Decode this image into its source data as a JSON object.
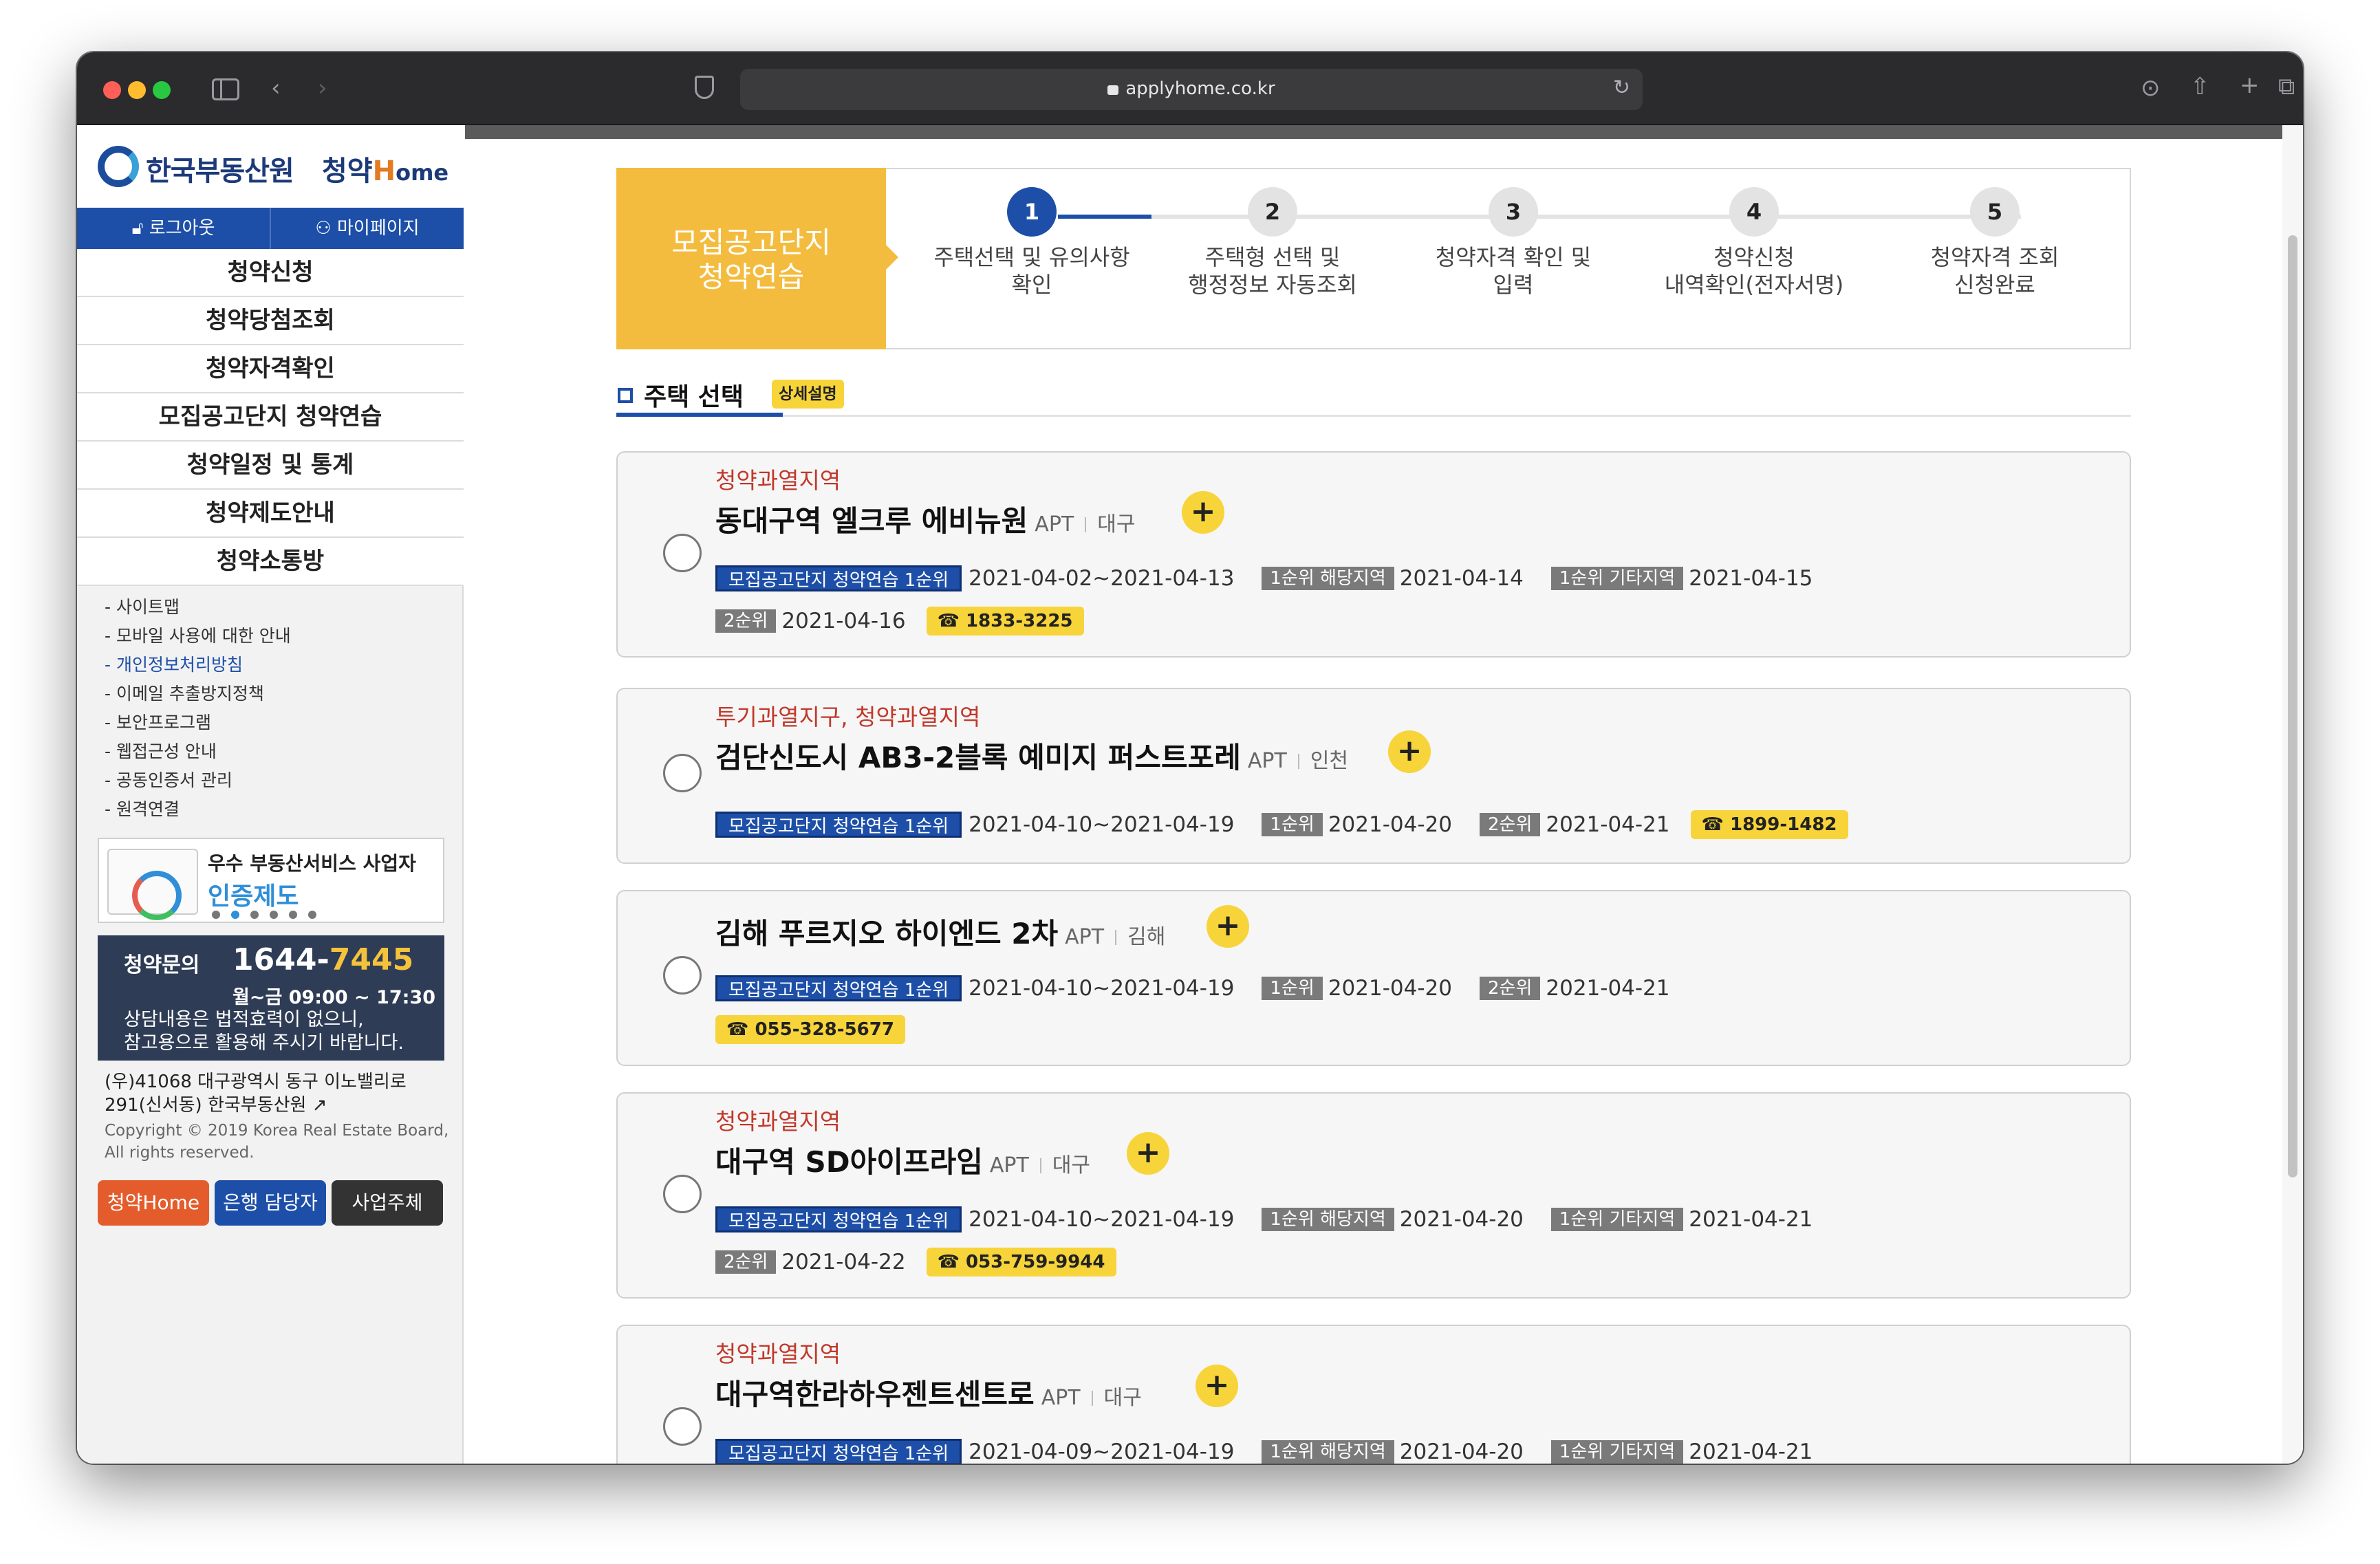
{
  "browser": {
    "url": "applyhome.co.kr"
  },
  "sidebar": {
    "logo_text": "한국부동산원",
    "logo_brand_prefix": "청약",
    "logo_brand_h": "H",
    "logo_brand_suffix": "ome",
    "logout": "로그아웃",
    "mypage": "마이페이지",
    "menu": [
      "청약신청",
      "청약당첨조회",
      "청약자격확인",
      "모집공고단지 청약연습",
      "청약일정 및 통계",
      "청약제도안내",
      "청약소통방"
    ],
    "links": [
      "- 사이트맵",
      "- 모바일 사용에 대한 안내",
      "- 개인정보처리방침",
      "- 이메일 추출방지정책",
      "- 보안프로그램",
      "- 웹접근성 안내",
      "- 공동인증서 관리",
      "- 원격연결"
    ],
    "cert_line1": "우수 부동산서비스 사업자",
    "cert_line2": "인증제도",
    "inquiry_label": "청약문의",
    "inquiry_phone_a": "1644-",
    "inquiry_phone_b": "7445",
    "inquiry_hours": "월~금 09:00 ~ 17:30",
    "inquiry_note1": "상담내용은 법적효력이 없으니,",
    "inquiry_note2": "참고용으로 활용해 주시기 바랍니다.",
    "address1": "(우)41068 대구광역시 동구 이노밸리로",
    "address2": "291(신서동) 한국부동산원",
    "copyright1": "Copyright © 2019 Korea Real Estate Board,",
    "copyright2": "All rights reserved.",
    "btn_home": "청약Home",
    "btn_bank": "은행 담당자",
    "btn_biz": "사업주체"
  },
  "steps": {
    "title1": "모집공고단지",
    "title2": "청약연습",
    "items": [
      {
        "num": "1",
        "line1": "주택선택 및 유의사항",
        "line2": "확인"
      },
      {
        "num": "2",
        "line1": "주택형 선택 및",
        "line2": "행정정보 자동조회"
      },
      {
        "num": "3",
        "line1": "청약자격 확인 및",
        "line2": "입력"
      },
      {
        "num": "4",
        "line1": "청약신청",
        "line2": "내역확인(전자서명)"
      },
      {
        "num": "5",
        "line1": "청약자격 조회",
        "line2": "신청완료"
      }
    ]
  },
  "section": {
    "title": "주택 선택",
    "badge": "상세설명"
  },
  "cards": [
    {
      "tag": "청약과열지역",
      "name": "동대구역 엘크루 에비뉴원",
      "type": "APT",
      "region": "대구",
      "row1": [
        {
          "label": "모집공고단지 청약연습 1순위",
          "kind": "blue",
          "date": "2021-04-02~2021-04-13"
        },
        {
          "label": "1순위 해당지역",
          "kind": "gray",
          "date": "2021-04-14"
        },
        {
          "label": "1순위 기타지역",
          "kind": "gray",
          "date": "2021-04-15"
        }
      ],
      "row2": [
        {
          "label": "2순위",
          "kind": "gray",
          "date": "2021-04-16"
        }
      ],
      "phone": "☎ 1833-3225"
    },
    {
      "tag": "투기과열지구, 청약과열지역",
      "name": "검단신도시 AB3-2블록 예미지 퍼스트포레",
      "type": "APT",
      "region": "인천",
      "row1": [
        {
          "label": "모집공고단지 청약연습 1순위",
          "kind": "blue",
          "date": "2021-04-10~2021-04-19"
        },
        {
          "label": "1순위",
          "kind": "gray",
          "date": "2021-04-20"
        },
        {
          "label": "2순위",
          "kind": "gray",
          "date": "2021-04-21"
        }
      ],
      "row2": [],
      "phone": "☎ 1899-1482"
    },
    {
      "tag": "",
      "name": "김해 푸르지오 하이엔드 2차",
      "type": "APT",
      "region": "김해",
      "row1": [
        {
          "label": "모집공고단지 청약연습 1순위",
          "kind": "blue",
          "date": "2021-04-10~2021-04-19"
        },
        {
          "label": "1순위",
          "kind": "gray",
          "date": "2021-04-20"
        },
        {
          "label": "2순위",
          "kind": "gray",
          "date": "2021-04-21"
        }
      ],
      "row2": [],
      "phone": "☎ 055-328-5677"
    },
    {
      "tag": "청약과열지역",
      "name": "대구역 SD아이프라임",
      "type": "APT",
      "region": "대구",
      "row1": [
        {
          "label": "모집공고단지 청약연습 1순위",
          "kind": "blue",
          "date": "2021-04-10~2021-04-19"
        },
        {
          "label": "1순위 해당지역",
          "kind": "gray",
          "date": "2021-04-20"
        },
        {
          "label": "1순위 기타지역",
          "kind": "gray",
          "date": "2021-04-21"
        }
      ],
      "row2": [
        {
          "label": "2순위",
          "kind": "gray",
          "date": "2021-04-22"
        }
      ],
      "phone": "☎ 053-759-9944"
    },
    {
      "tag": "청약과열지역",
      "name": "대구역한라하우젠트센트로",
      "type": "APT",
      "region": "대구",
      "row1": [
        {
          "label": "모집공고단지 청약연습 1순위",
          "kind": "blue",
          "date": "2021-04-09~2021-04-19"
        },
        {
          "label": "1순위 해당지역",
          "kind": "gray",
          "date": "2021-04-20"
        },
        {
          "label": "1순위 기타지역",
          "kind": "gray",
          "date": "2021-04-21"
        }
      ],
      "row2": [],
      "phone": ""
    }
  ],
  "icons": {
    "plus": "+",
    "step_active_color": "#1d4fa8",
    "accent_yellow": "#f7d43a",
    "tag_red": "#c0392b"
  }
}
